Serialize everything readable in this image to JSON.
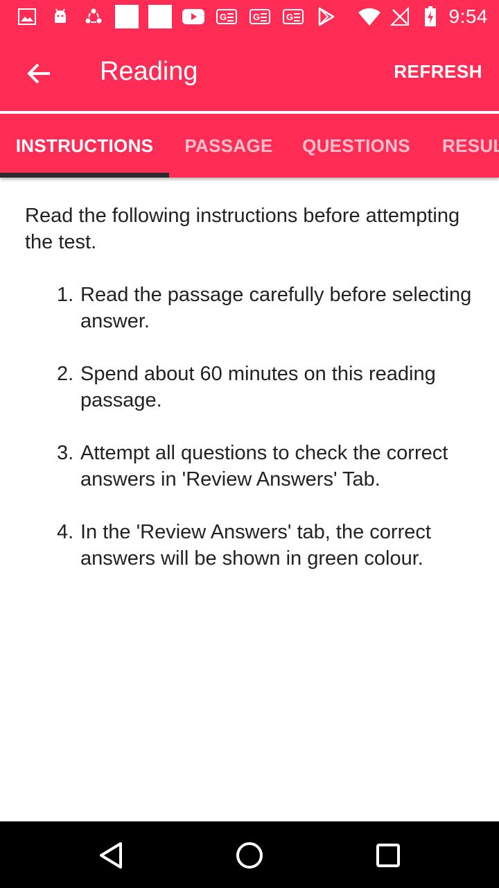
{
  "status_bar": {
    "time": "9:54",
    "left_icons": [
      "image-icon",
      "android-icon",
      "sync-icon",
      "blank-square-icon",
      "blank-square-icon",
      "youtube-icon",
      "translate-icon",
      "translate-icon",
      "translate-icon",
      "play-store-icon"
    ],
    "right_icons": [
      "wifi-icon",
      "no-signal-icon",
      "battery-charging-icon"
    ]
  },
  "app_bar": {
    "title": "Reading",
    "action_label": "REFRESH"
  },
  "tabs": [
    {
      "label": "INSTRUCTIONS",
      "active": true
    },
    {
      "label": "PASSAGE",
      "active": false
    },
    {
      "label": "QUESTIONS",
      "active": false
    },
    {
      "label": "RESULT",
      "active": false
    }
  ],
  "content": {
    "intro": "Read the following instructions before attempting the test.",
    "items": [
      {
        "num": "1.",
        "text": "Read the passage carefully before selecting answer."
      },
      {
        "num": "2.",
        "text": "Spend about 60 minutes on this reading passage."
      },
      {
        "num": "3.",
        "text": "Attempt all questions to check the correct answers in 'Review Answers' Tab."
      },
      {
        "num": "4.",
        "text": "In the 'Review Answers' tab, the correct answers will be shown in green colour."
      }
    ]
  },
  "colors": {
    "primary": "#ff2d55",
    "tab_indicator": "#2b2b2b",
    "text": "#222222",
    "nav_bar": "#000000"
  }
}
